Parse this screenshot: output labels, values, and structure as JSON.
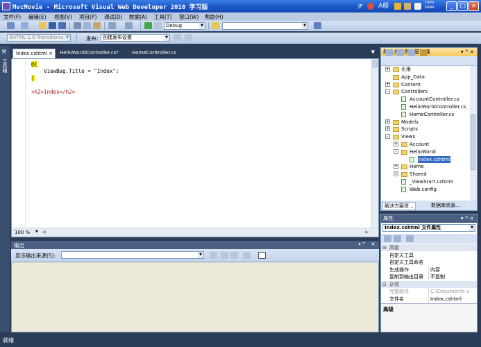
{
  "window": {
    "title": "MvcMovie - Microsoft Visual Web Developer 2010 学习版"
  },
  "tray": {
    "lang": "JP",
    "ime": "A般",
    "caps1": "CAPS",
    "caps2": "KANA"
  },
  "menu": [
    "文件(F)",
    "编辑(E)",
    "视图(V)",
    "项目(P)",
    "调试(D)",
    "数据(A)",
    "工具(T)",
    "窗口(W)",
    "帮助(H)"
  ],
  "toolbar1": {
    "config": "Debug",
    "search": ""
  },
  "toolbar2": {
    "schema": "XHTML 1.0 Transitiona",
    "publish_label": "发布:",
    "publish_value": "创建发布设置"
  },
  "toolbox": {
    "label": "工具箱"
  },
  "tabs": [
    {
      "label": "Index.cshtml",
      "active": true,
      "close": "×"
    },
    {
      "label": "HelloWorldController.cs*"
    },
    {
      "label": "HomeController.cs"
    }
  ],
  "editor": {
    "lines": [
      "@{",
      "    ViewBag.Title = \"Index\";",
      "}",
      "",
      "<h2>Index</h2>"
    ],
    "zoom": "100 %"
  },
  "output": {
    "title": "输出",
    "source_label": "显示输出来源(S):",
    "source_value": ""
  },
  "solution": {
    "title": "解决方案资源管理器",
    "tree": [
      {
        "label": "引用",
        "depth": 1,
        "type": "folder",
        "expander": "+"
      },
      {
        "label": "App_Data",
        "depth": 1,
        "type": "folder",
        "expander": ""
      },
      {
        "label": "Content",
        "depth": 1,
        "type": "folder",
        "expander": "+"
      },
      {
        "label": "Controllers",
        "depth": 1,
        "type": "folder",
        "expander": "-"
      },
      {
        "label": "AccountController.cs",
        "depth": 2,
        "type": "file",
        "expander": ""
      },
      {
        "label": "HelloWorldController.cs",
        "depth": 2,
        "type": "file",
        "expander": ""
      },
      {
        "label": "HomeController.cs",
        "depth": 2,
        "type": "file",
        "expander": ""
      },
      {
        "label": "Models",
        "depth": 1,
        "type": "folder",
        "expander": "+"
      },
      {
        "label": "Scripts",
        "depth": 1,
        "type": "folder",
        "expander": "+"
      },
      {
        "label": "Views",
        "depth": 1,
        "type": "folder",
        "expander": "-"
      },
      {
        "label": "Account",
        "depth": 2,
        "type": "folder",
        "expander": "+"
      },
      {
        "label": "HelloWorld",
        "depth": 2,
        "type": "folder",
        "expander": "-"
      },
      {
        "label": "Index.cshtml",
        "depth": 3,
        "type": "file",
        "expander": "",
        "selected": true
      },
      {
        "label": "Home",
        "depth": 2,
        "type": "folder",
        "expander": "+"
      },
      {
        "label": "Shared",
        "depth": 2,
        "type": "folder",
        "expander": "+"
      },
      {
        "label": "_ViewStart.cshtml",
        "depth": 2,
        "type": "file",
        "expander": ""
      },
      {
        "label": "Web.config",
        "depth": 2,
        "type": "file",
        "expander": ""
      }
    ],
    "tab1": "解决方案资...",
    "tab2": "数据库资源..."
  },
  "properties": {
    "title": "属性",
    "object": "Index.cshtml 文件属性",
    "rows": [
      {
        "cat": true,
        "label": "高级",
        "sign": "⊟"
      },
      {
        "k": "自定义工具",
        "v": ""
      },
      {
        "k": "自定义工具命名",
        "v": ""
      },
      {
        "k": "生成操作",
        "v": "内容"
      },
      {
        "k": "复制到输出目录",
        "v": "不复制"
      },
      {
        "cat": true,
        "label": "杂项",
        "sign": "⊟"
      },
      {
        "k": "完整路径",
        "v": "C:\\Documents a",
        "gray": true
      },
      {
        "k": "文件名",
        "v": "Index.cshtml"
      }
    ],
    "desc": "高级"
  },
  "status": {
    "text": "就绪"
  }
}
